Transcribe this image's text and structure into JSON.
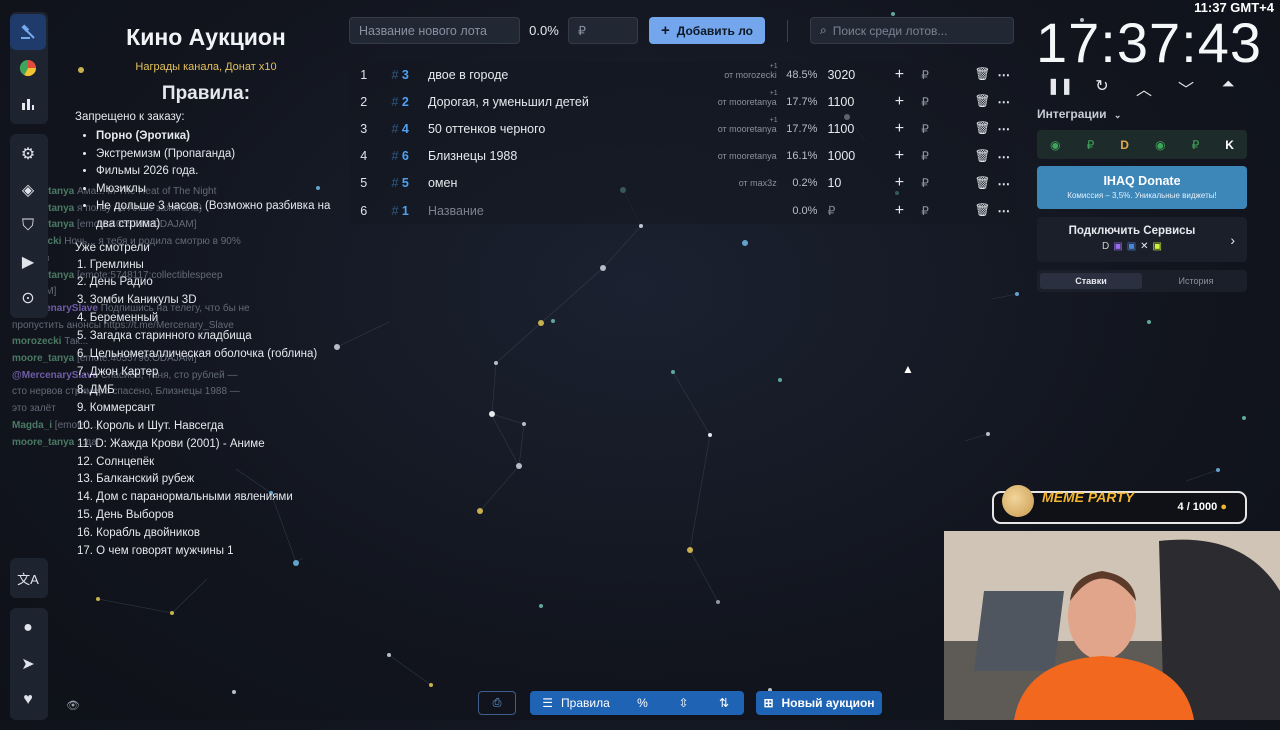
{
  "rules": {
    "title": "Кино Аукцион",
    "subtitle": "Награды канала, Донат x10",
    "heading": "Правила:",
    "forbidden_label": "Запрещено к заказу:",
    "forbidden": [
      {
        "text": "Порно (Эротика)",
        "bold": true
      },
      {
        "text": "Экстремизм (Пропаганда)",
        "bold": false
      },
      {
        "text": "Фильмы 2026 года.",
        "bold": false
      },
      {
        "text": "Мюзиклы",
        "bold": false
      },
      {
        "text": "Не дольше 3 часов. (Возможно разбивка на два стрима)",
        "bold": false
      }
    ],
    "seen_label": "Уже смотрели",
    "seen": [
      "1. Гремлины",
      "2. День Радио",
      "3. Зомби Каникулы 3D",
      "4. Беременный",
      "5. Загадка старинного кладбища",
      "6. Цельнометаллическая оболочка (гоблина)",
      "7. Джон Картер",
      "8. ДМБ",
      "9. Коммерсант",
      "10. Король и Шут. Навсегда",
      "11. D: Жажда Крови (2001) - Аниме",
      "12. Солнцепёк",
      "13. Балканский рубеж",
      "14. Дом с паранормальными явлениями",
      "15. День Выборов",
      "16. Корабль двойников",
      "17. О чем говорят мужчины 1"
    ]
  },
  "chat": [
    {
      "user": "moore_tanya",
      "text": "Ама... In The Heat of The Night"
    },
    {
      "user": "moore_tanya",
      "text": "я ползу на Алые зажигала)"
    },
    {
      "user": "moore_tanya",
      "text": "[emote:4055796:ODAJAM]"
    },
    {
      "user": "morozecki",
      "text": "Ночь... я тебя и родила смотрю в 90% случаев"
    },
    {
      "user": "moore_tanya",
      "text": "[emote:5748117:collectiblespeep ODAJAM]"
    },
    {
      "user": "@MercenarySlave",
      "text": "Подпишись на телегу, что бы не пропустить анонсы https://t.me/Mercenary_Slave"
    },
    {
      "user": "morozecki",
      "text": "Так..."
    },
    {
      "user": "moore_tanya",
      "text": "[emote:4055796:ODAJAM]"
    },
    {
      "user": "@MercenarySlave",
      "text": "Спасибо, Таня, сто рублей — сто нервов стримера спасено, Близнецы 1988 — это залёт"
    },
    {
      "user": "Magda_i",
      "text": "[emote:...]"
    },
    {
      "user": "moore_tanya",
      "text": "...да"
    }
  ],
  "toolbar": {
    "lot_name_placeholder": "Название нового лота",
    "percent": "0.0%",
    "amount_placeholder": "₽",
    "add_label": "Добавить ло",
    "search_placeholder": "Поиск среди лотов..."
  },
  "lots": [
    {
      "num": "1",
      "id": "3",
      "name": "двое в городе",
      "from": "от morozecki",
      "extra": "+1",
      "pct": "48.5%",
      "amount": "3020",
      "currency": "₽"
    },
    {
      "num": "2",
      "id": "2",
      "name": "Дорогая, я уменьшил детей",
      "from": "от mooretanya",
      "extra": "+1",
      "pct": "17.7%",
      "amount": "1100",
      "currency": "₽"
    },
    {
      "num": "3",
      "id": "4",
      "name": "50 оттенков черного",
      "from": "от mooretanya",
      "extra": "+1",
      "pct": "17.7%",
      "amount": "1100",
      "currency": "₽"
    },
    {
      "num": "4",
      "id": "6",
      "name": "Близнецы 1988",
      "from": "от mooretanya",
      "extra": "",
      "pct": "16.1%",
      "amount": "1000",
      "currency": "₽"
    },
    {
      "num": "5",
      "id": "5",
      "name": "омен",
      "from": "от max3z",
      "extra": "",
      "pct": "0.2%",
      "amount": "10",
      "currency": "₽"
    },
    {
      "num": "6",
      "id": "1",
      "name": "",
      "name_placeholder": "Название",
      "from": "",
      "extra": "",
      "pct": "0.0%",
      "amount": "",
      "amount_placeholder": "₽",
      "currency": "₽"
    }
  ],
  "timer": {
    "value": "17:37:43"
  },
  "clock": {
    "value": "11:37 GMT+4"
  },
  "integrations": {
    "label": "Интеграции",
    "services": [
      "₽",
      "D",
      "₽",
      "K"
    ]
  },
  "donate": {
    "title": "IHAQ Donate",
    "subtitle": "Комиссия – 3,5%. Уникальные виджеты!"
  },
  "connect": {
    "title": "Подключить Сервисы"
  },
  "tabs": {
    "bets": "Ставки",
    "history": "История"
  },
  "meme": {
    "title": "MEME PARTY",
    "count": "4 / 1000"
  },
  "bottom": {
    "rules_label": "Правила",
    "new_auction_label": "Новый аукцион"
  },
  "colors": {
    "accent": "#73a6ec",
    "primary_button": "#1f63b4",
    "donate": "#3d86b8",
    "gold": "#e2c15a"
  }
}
